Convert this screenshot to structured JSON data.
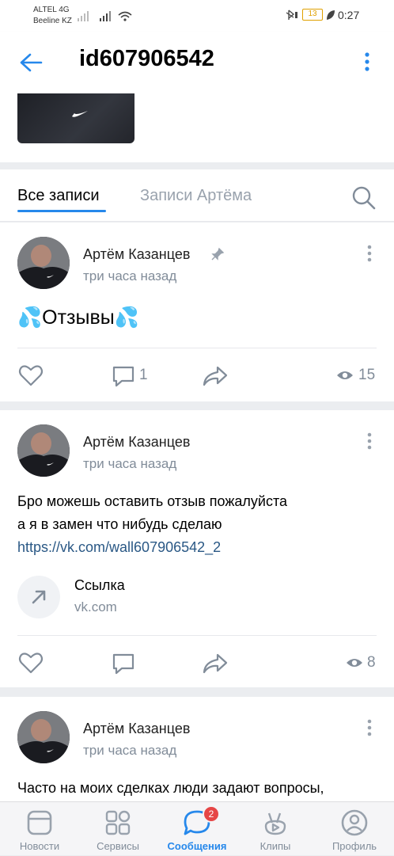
{
  "status_bar": {
    "carrier1": "ALTEL 4G",
    "carrier2": "Beeline KZ",
    "battery": "13",
    "time": "0:27"
  },
  "header": {
    "title": "id607906542"
  },
  "tabs": {
    "all_posts": "Все записи",
    "user_posts": "Записи Артёма"
  },
  "posts": [
    {
      "author": "Артём Казанцев",
      "time": "три часа назад",
      "text": "💦Отзывы💦",
      "comments": "1",
      "views": "15",
      "pinned": true
    },
    {
      "author": "Артём Казанцев",
      "time": "три часа назад",
      "text_line1": "Бро можешь оставить отзыв пожалуйста",
      "text_line2": "а я в замен что нибудь сделаю",
      "link": "https://vk.com/wall607906542_2",
      "attachment_title": "Ссылка",
      "attachment_domain": "vk.com",
      "views": "8"
    },
    {
      "author": "Артём Казанцев",
      "time": "три часа назад",
      "text": "Часто на моих сделках люди задают вопросы,"
    }
  ],
  "bottom_nav": {
    "news": "Новости",
    "services": "Сервисы",
    "messages": "Сообщения",
    "messages_badge": "2",
    "clips": "Клипы",
    "profile": "Профиль",
    "active": "messages"
  },
  "colors": {
    "accent": "#2688eb",
    "link": "#2a5885",
    "secondary_text": "#818c99",
    "badge": "#e64646"
  }
}
